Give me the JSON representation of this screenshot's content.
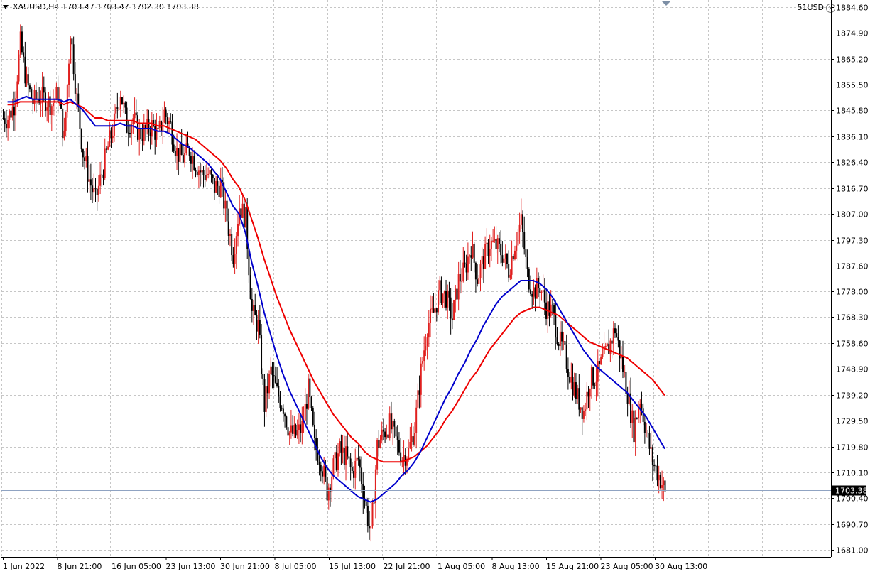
{
  "header": {
    "symbol": "XAUUSD,H4",
    "ohlc": "1703.47 1703.47 1702.30 1703.38",
    "account": "51USD"
  },
  "colors": {
    "grid": "#c6c6c6",
    "bull_candle": "#e0201f",
    "bear_candle": "#000000",
    "ma_fast": "#0000cc",
    "ma_slow": "#ee0000",
    "price_line": "#8fa3c2",
    "axis": "#000000"
  },
  "chart_data": {
    "type": "line",
    "y_ticks": [
      "1884.60",
      "1874.90",
      "1865.20",
      "1855.50",
      "1845.80",
      "1836.10",
      "1826.40",
      "1816.70",
      "1807.00",
      "1797.30",
      "1787.60",
      "1778.00",
      "1768.30",
      "1758.60",
      "1748.90",
      "1739.20",
      "1729.50",
      "1719.80",
      "1710.10",
      "1700.40",
      "1690.70",
      "1681.00"
    ],
    "ylim": [
      1678.4,
      1887.2
    ],
    "x_ticks": [
      "1 Jun 2022",
      "8 Jun 21:00",
      "16 Jun 05:00",
      "23 Jun 13:00",
      "30 Jun 21:00",
      "8 Jul 05:00",
      "15 Jul 13:00",
      "22 Jul 21:00",
      "1 Aug 05:00",
      "8 Aug 13:00",
      "15 Aug 21:00",
      "23 Aug 05:00",
      "30 Aug 13:00"
    ],
    "current_price": "1703.38",
    "grid": true,
    "series": [
      {
        "values": [
          1843,
          1848,
          1871,
          1856,
          1849,
          1851,
          1850,
          1848,
          1852,
          1835,
          1876,
          1850,
          1830,
          1820,
          1812,
          1822,
          1832,
          1841,
          1853,
          1840,
          1843,
          1837,
          1838,
          1840,
          1836,
          1845,
          1840,
          1830,
          1828,
          1831,
          1826,
          1822,
          1822,
          1817,
          1818,
          1805,
          1792,
          1810,
          1805,
          1770,
          1765,
          1735,
          1748,
          1740,
          1735,
          1725,
          1724,
          1727,
          1741,
          1720,
          1715,
          1703,
          1712,
          1718,
          1716,
          1710,
          1715,
          1700,
          1686,
          1720,
          1725,
          1728,
          1722,
          1716,
          1718,
          1727,
          1748,
          1765,
          1770,
          1778,
          1776,
          1768,
          1782,
          1786,
          1795,
          1783,
          1790,
          1796,
          1795,
          1792,
          1786,
          1796,
          1804,
          1784,
          1778,
          1780,
          1772,
          1770,
          1760,
          1754,
          1745,
          1738,
          1733,
          1745,
          1746,
          1752,
          1757,
          1764,
          1752,
          1740,
          1726,
          1738,
          1725,
          1714,
          1709,
          1703
        ]
      },
      {
        "name": "",
        "values": [
          1849,
          1849,
          1850,
          1851,
          1850,
          1850,
          1850,
          1850,
          1850,
          1849,
          1850,
          1848,
          1846,
          1843,
          1840,
          1840,
          1840,
          1840,
          1841,
          1840,
          1840,
          1839,
          1839,
          1839,
          1838,
          1838,
          1837,
          1835,
          1833,
          1832,
          1830,
          1828,
          1826,
          1823,
          1820,
          1815,
          1810,
          1807,
          1800,
          1789,
          1780,
          1770,
          1762,
          1754,
          1747,
          1741,
          1736,
          1731,
          1726,
          1721,
          1716,
          1712,
          1709,
          1707,
          1705,
          1703,
          1701,
          1700,
          1699,
          1700,
          1702,
          1704,
          1706,
          1709,
          1711,
          1714,
          1718,
          1723,
          1728,
          1733,
          1738,
          1742,
          1747,
          1751,
          1756,
          1760,
          1765,
          1769,
          1773,
          1776,
          1778,
          1780,
          1782,
          1782,
          1782,
          1781,
          1779,
          1776,
          1772,
          1768,
          1764,
          1760,
          1756,
          1753,
          1750,
          1748,
          1746,
          1744,
          1742,
          1740,
          1737,
          1734,
          1731,
          1727,
          1723,
          1719
        ]
      },
      {
        "name": "",
        "values": [
          1848,
          1848,
          1849,
          1849,
          1849,
          1849,
          1849,
          1849,
          1849,
          1848,
          1849,
          1848,
          1847,
          1845,
          1843,
          1843,
          1842,
          1842,
          1842,
          1842,
          1842,
          1841,
          1841,
          1841,
          1840,
          1840,
          1839,
          1838,
          1837,
          1836,
          1835,
          1833,
          1831,
          1829,
          1827,
          1824,
          1820,
          1817,
          1812,
          1805,
          1798,
          1790,
          1783,
          1776,
          1770,
          1764,
          1759,
          1754,
          1749,
          1744,
          1740,
          1736,
          1732,
          1729,
          1726,
          1723,
          1721,
          1718,
          1716,
          1715,
          1714,
          1714,
          1714,
          1714,
          1715,
          1716,
          1718,
          1720,
          1723,
          1726,
          1730,
          1733,
          1737,
          1741,
          1745,
          1748,
          1752,
          1756,
          1759,
          1762,
          1765,
          1768,
          1770,
          1771,
          1772,
          1772,
          1771,
          1770,
          1769,
          1767,
          1765,
          1763,
          1761,
          1759,
          1758,
          1757,
          1756,
          1755,
          1754,
          1753,
          1751,
          1749,
          1747,
          1745,
          1742,
          1739
        ]
      }
    ]
  }
}
